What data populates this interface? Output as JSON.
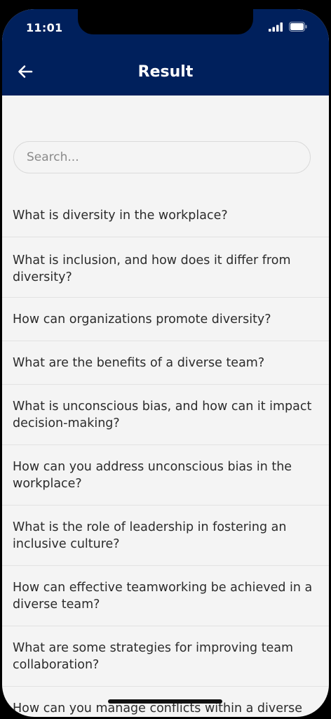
{
  "status_bar": {
    "time": "11:01"
  },
  "header": {
    "title": "Result",
    "back_icon": "arrow-left-icon"
  },
  "search": {
    "placeholder": "Search..."
  },
  "colors": {
    "header_bg": "#00205c",
    "page_bg": "#f4f4f4",
    "text": "#2b2b2b"
  },
  "questions": [
    "What is diversity in the workplace?",
    "What is inclusion, and how does it differ from diversity?",
    "How can organizations promote diversity?",
    "What are the benefits of a diverse team?",
    "What is unconscious bias, and how can it impact decision-making?",
    "How can you address unconscious bias in the workplace?",
    "What is the role of leadership in fostering an inclusive culture?",
    "How can effective teamworking be achieved in a diverse team?",
    "What are some strategies for improving team collaboration?",
    "How can you manage conflicts within a diverse"
  ]
}
